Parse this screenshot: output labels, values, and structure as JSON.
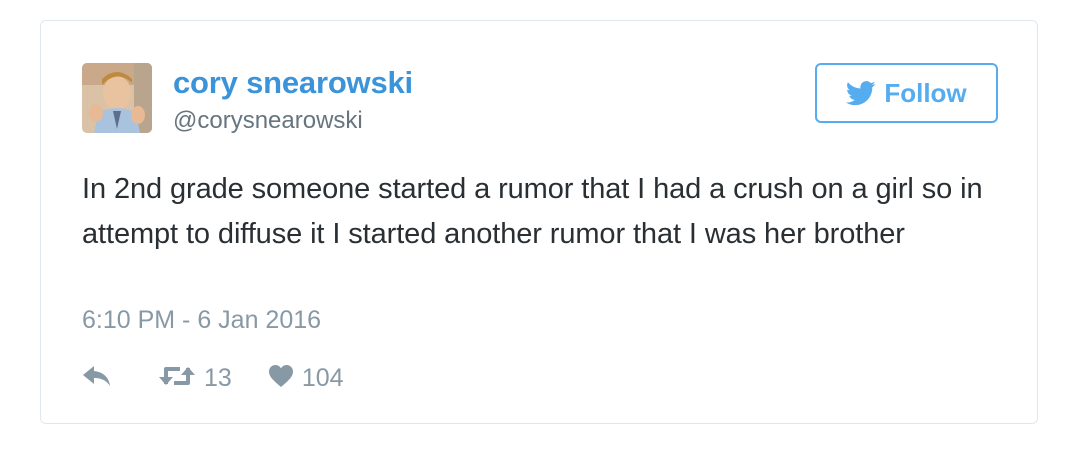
{
  "user": {
    "name": "cory snearowski",
    "screen_name": "@corysnearowski"
  },
  "follow_button": {
    "label": "Follow",
    "icon": "twitter-bird-icon"
  },
  "tweet": {
    "text": "In 2nd grade someone started a rumor that I had a crush on a girl so in attempt to diffuse it I started another rumor that I was her brother",
    "timestamp": "6:10 PM - 6 Jan 2016"
  },
  "actions": {
    "reply": {
      "icon": "reply-icon"
    },
    "retweet": {
      "icon": "retweet-icon",
      "count": "13"
    },
    "like": {
      "icon": "heart-icon",
      "count": "104"
    }
  },
  "colors": {
    "brand_blue": "#55acee",
    "name_blue": "#3b94d9",
    "text": "#292f33",
    "muted": "#8899a6",
    "border": "#e1e8ed"
  }
}
